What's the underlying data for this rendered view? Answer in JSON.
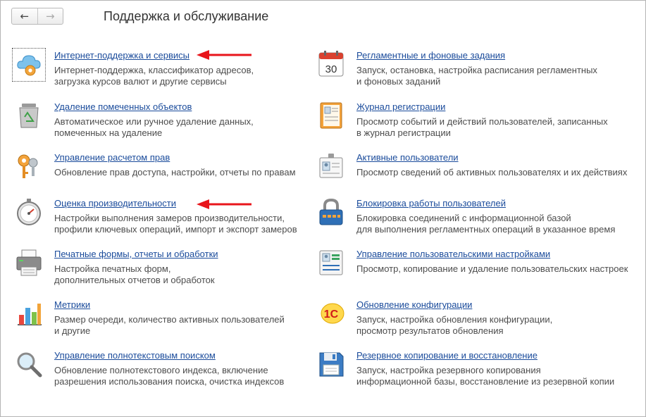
{
  "window": {
    "title": "Поддержка и обслуживание",
    "nav": {
      "back": "←",
      "forward": "→"
    }
  },
  "left_items": [
    {
      "label": "Интернет-поддержка и сервисы",
      "desc1": "Интернет-поддержка, классификатор адресов,",
      "desc2": "загрузка курсов валют и другие сервисы",
      "icon": "cloud-gear-icon"
    },
    {
      "label": "Удаление помеченных объектов",
      "desc1": "Автоматическое или ручное удаление данных,",
      "desc2": "помеченных на удаление",
      "icon": "recycle-bin-icon"
    },
    {
      "label": "Управление расчетом прав",
      "desc1": "Обновление прав доступа, настройки, отчеты по правам",
      "desc2": "",
      "icon": "keys-icon"
    },
    {
      "label": "Оценка производительности",
      "desc1": "Настройки выполнения замеров производительности,",
      "desc2": "профили ключевых операций, импорт и экспорт замеров",
      "icon": "stopwatch-icon"
    },
    {
      "label": "Печатные формы, отчеты и обработки",
      "desc1": "Настройка печатных форм,",
      "desc2": "дополнительных отчетов и обработок",
      "icon": "printer-icon"
    },
    {
      "label": "Метрики",
      "desc1": "Размер очереди, количество активных пользователей",
      "desc2": "и другие",
      "icon": "bar-chart-icon"
    },
    {
      "label": "Управление полнотекстовым поиском",
      "desc1": "Обновление полнотекстового индекса, включение",
      "desc2": "разрешения использования поиска, очистка индексов",
      "icon": "magnifier-icon"
    }
  ],
  "right_items": [
    {
      "label": "Регламентные и фоновые задания",
      "desc1": "Запуск, остановка, настройка расписания регламентных",
      "desc2": "и фоновых заданий",
      "icon": "calendar-icon",
      "icon_text": "30"
    },
    {
      "label": "Журнал регистрации",
      "desc1": "Просмотр событий и действий пользователей, записанных",
      "desc2": "в журнал регистрации",
      "icon": "journal-icon"
    },
    {
      "label": "Активные пользователи",
      "desc1": "Просмотр сведений об активных пользователях и их действиях",
      "desc2": "",
      "icon": "badge-icon"
    },
    {
      "label": "Блокировка работы пользователей",
      "desc1": "Блокировка соединений с информационной базой",
      "desc2": "для выполнения регламентных операций в указанное время",
      "icon": "lock-icon"
    },
    {
      "label": "Управление пользовательскими настройками",
      "desc1": "Просмотр, копирование и удаление пользовательских настроек",
      "desc2": "",
      "icon": "user-settings-icon"
    },
    {
      "label": "Обновление конфигурации",
      "desc1": "Запуск, настройка обновления конфигурации,",
      "desc2": "просмотр результатов обновления",
      "icon": "1c-logo-icon",
      "icon_text": "1С"
    },
    {
      "label": "Резервное копирование и восстановление",
      "desc1": "Запуск, настройка резервного копирования",
      "desc2": "информационной базы, восстановление из резервной копии",
      "icon": "floppy-disk-icon"
    }
  ],
  "colors": {
    "link": "#1a4b9b",
    "arrow": "#e8151b"
  }
}
